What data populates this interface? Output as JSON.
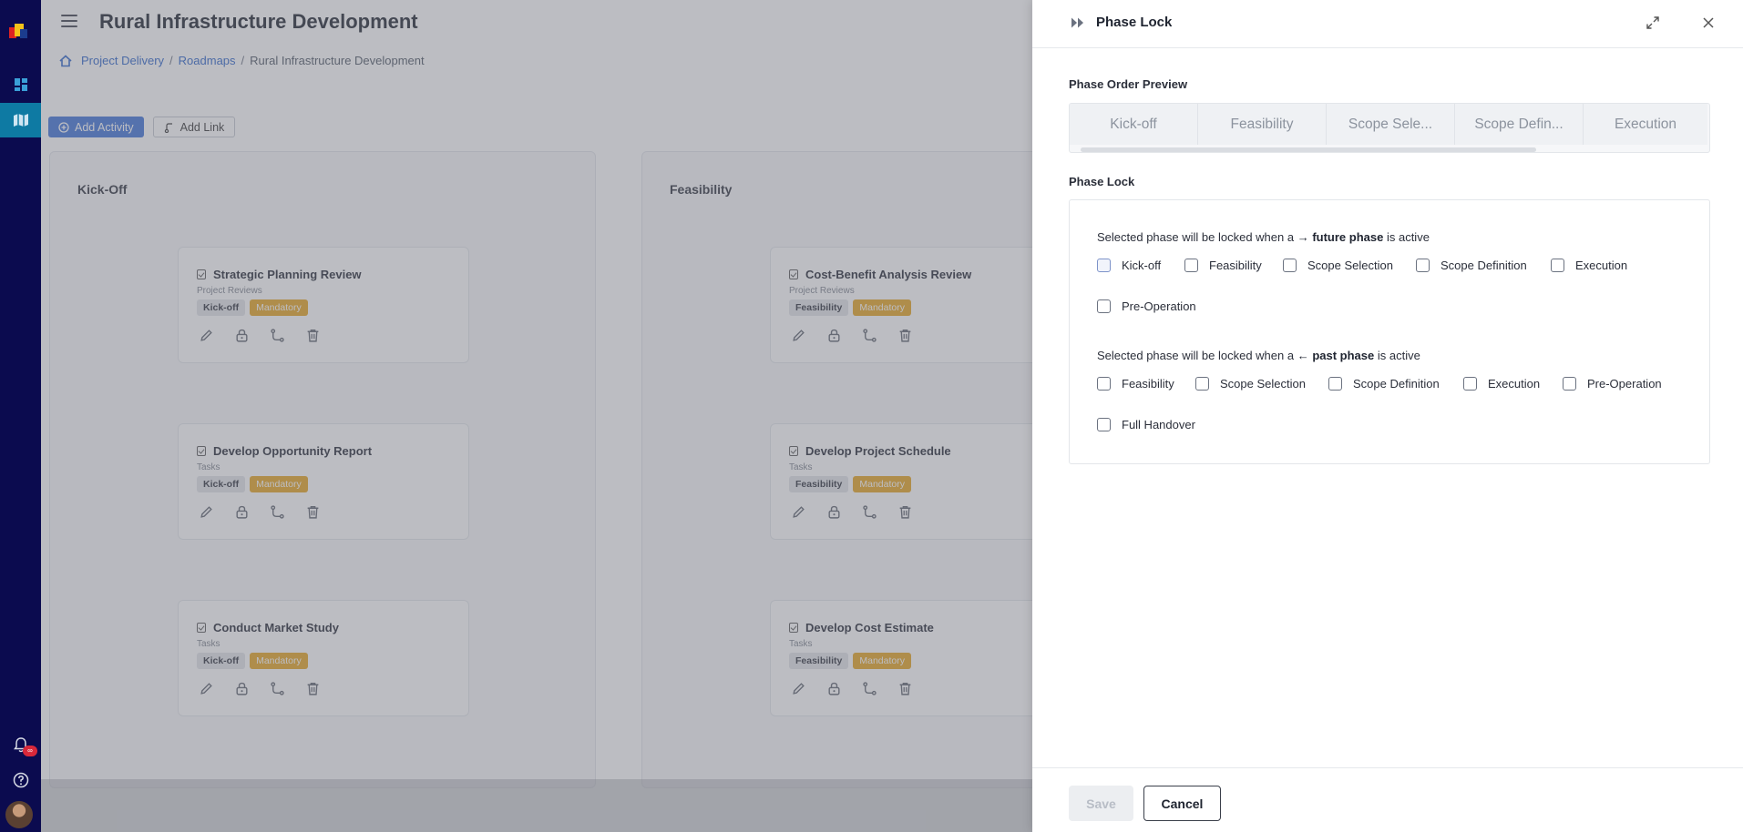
{
  "app": {
    "page_title": "Rural Infrastructure Development",
    "breadcrumb": [
      "Project Delivery",
      "Roadmaps",
      "Rural Infrastructure Development"
    ],
    "breadcrumb_sep": "/",
    "actions": {
      "add_activity": "Add Activity",
      "add_link": "Add Link"
    },
    "notification_badge": "∞",
    "lanes": [
      {
        "title": "Kick-Off",
        "cards": [
          {
            "title": "Strategic Planning Review",
            "subtitle": "Project Reviews",
            "tag": "Kick-off",
            "flag": "Mandatory"
          },
          {
            "title": "Develop Opportunity Report",
            "subtitle": "Tasks",
            "tag": "Kick-off",
            "flag": "Mandatory"
          },
          {
            "title": "Conduct Market Study",
            "subtitle": "Tasks",
            "tag": "Kick-off",
            "flag": "Mandatory"
          }
        ]
      },
      {
        "title": "Feasibility",
        "cards": [
          {
            "title": "Cost-Benefit Analysis Review",
            "subtitle": "Project Reviews",
            "tag": "Feasibility",
            "flag": "Mandatory"
          },
          {
            "title": "Develop Project Schedule",
            "subtitle": "Tasks",
            "tag": "Feasibility",
            "flag": "Mandatory"
          },
          {
            "title": "Develop Cost Estimate",
            "subtitle": "Tasks",
            "tag": "Feasibility",
            "flag": "Mandatory"
          }
        ]
      }
    ]
  },
  "panel": {
    "title": "Phase Lock",
    "preview_label": "Phase Order Preview",
    "preview_tabs": [
      "Kick-off",
      "Feasibility",
      "Scope Sele...",
      "Scope Defin...",
      "Execution"
    ],
    "lock_label": "Phase Lock",
    "future": {
      "desc_prefix": "Selected phase will be locked when a",
      "desc_bold": "→ future phase",
      "desc_suffix": "is active",
      "options": [
        "Kick-off",
        "Feasibility",
        "Scope Selection",
        "Scope Definition",
        "Execution",
        "Pre-Operation"
      ]
    },
    "past": {
      "desc_prefix": "Selected phase will be locked when a",
      "desc_bold": "← past phase",
      "desc_suffix": "is active",
      "options": [
        "Feasibility",
        "Scope Selection",
        "Scope Definition",
        "Execution",
        "Pre-Operation",
        "Full Handover"
      ]
    },
    "save_label": "Save",
    "cancel_label": "Cancel"
  },
  "colors": {
    "rail": "#0b0b4f",
    "rail_active": "#0e7aa3",
    "primary": "#3b6fd6",
    "mandatory": "#e7a41c",
    "link": "#2a62c9"
  }
}
